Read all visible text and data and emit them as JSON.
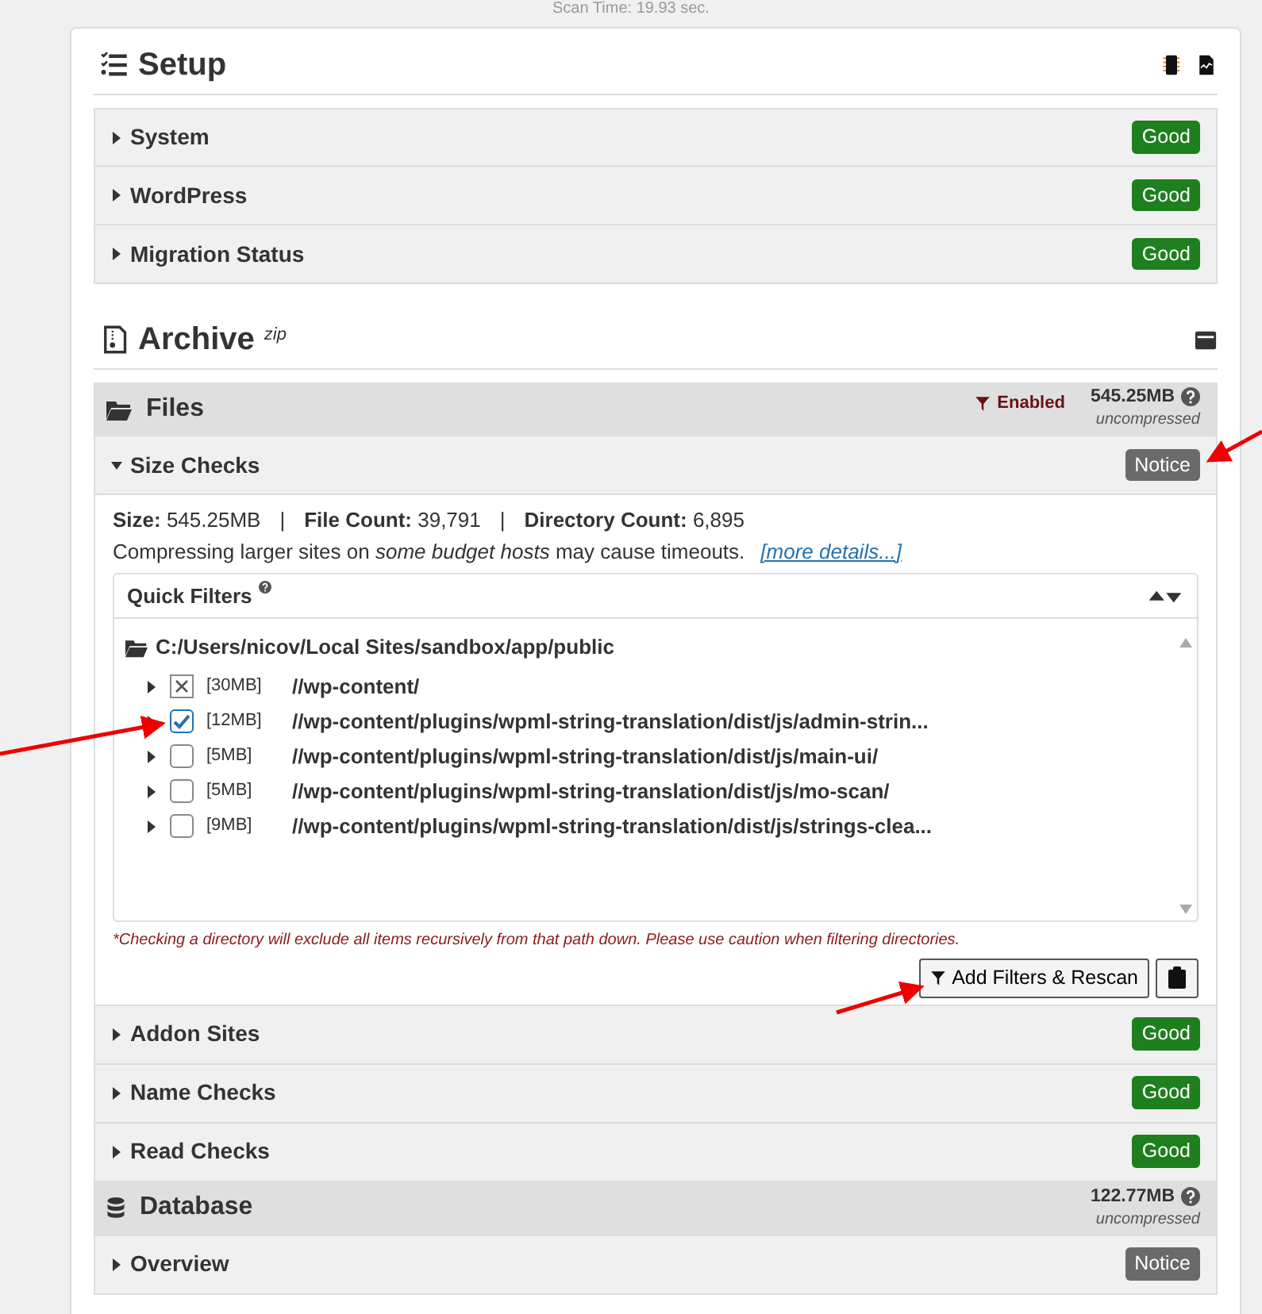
{
  "scan_time": "Scan Time: 19.93 sec.",
  "setup": {
    "title": "Setup",
    "rows": [
      {
        "label": "System",
        "expanded": false,
        "status": {
          "text": "Good",
          "kind": "good"
        }
      },
      {
        "label": "WordPress",
        "expanded": false,
        "status": {
          "text": "Good",
          "kind": "good"
        }
      },
      {
        "label": "Migration Status",
        "expanded": false,
        "status": {
          "text": "Good",
          "kind": "good"
        }
      }
    ]
  },
  "archive": {
    "title": "Archive",
    "suffix": "zip",
    "files": {
      "title": "Files",
      "filter_label": "Enabled",
      "size": "545.25MB",
      "size_note": "uncompressed"
    },
    "size_checks": {
      "label": "Size Checks",
      "expanded": true,
      "status": {
        "text": "Notice",
        "kind": "notice"
      },
      "summary": [
        {
          "label": "Size:",
          "value": "545.25MB"
        },
        {
          "label": "File Count:",
          "value": "39,791"
        },
        {
          "label": "Directory Count:",
          "value": "6,895"
        }
      ],
      "separator": "|",
      "message": "Compressing larger sites on *some budget hosts* may cause timeouts.",
      "link": "[more details...]",
      "quick_filters": {
        "title": "Quick Filters",
        "root": "C:/Users/nicov/Local Sites/sandbox/app/public",
        "items": [
          {
            "excluded": true,
            "checked": false,
            "size": "[30MB]",
            "path": "//wp-content/"
          },
          {
            "excluded": false,
            "checked": true,
            "size": "[12MB]",
            "path": "//wp-content/plugins/wpml-string-translation/dist/js/admin-strin..."
          },
          {
            "excluded": false,
            "checked": false,
            "size": "[5MB]",
            "path": "//wp-content/plugins/wpml-string-translation/dist/js/main-ui/"
          },
          {
            "excluded": false,
            "checked": false,
            "size": "[5MB]",
            "path": "//wp-content/plugins/wpml-string-translation/dist/js/mo-scan/"
          },
          {
            "excluded": false,
            "checked": false,
            "size": "[9MB]",
            "path": "//wp-content/plugins/wpml-string-translation/dist/js/strings-clea..."
          }
        ]
      },
      "footnote": "*Checking a directory will exclude all items recursively from that path down. Please use caution when filtering directories.",
      "rescan_button": "Add Filters & Rescan"
    },
    "rows": [
      {
        "label": "Addon Sites",
        "expanded": false,
        "status": {
          "text": "Good",
          "kind": "good"
        }
      },
      {
        "label": "Name Checks",
        "expanded": false,
        "status": {
          "text": "Good",
          "kind": "good"
        }
      },
      {
        "label": "Read Checks",
        "expanded": false,
        "status": {
          "text": "Good",
          "kind": "good"
        }
      }
    ],
    "database": {
      "title": "Database",
      "size": "122.77MB",
      "size_note": "uncompressed",
      "rows": [
        {
          "label": "Overview",
          "expanded": false,
          "status": {
            "text": "Notice",
            "kind": "notice"
          }
        }
      ]
    }
  }
}
